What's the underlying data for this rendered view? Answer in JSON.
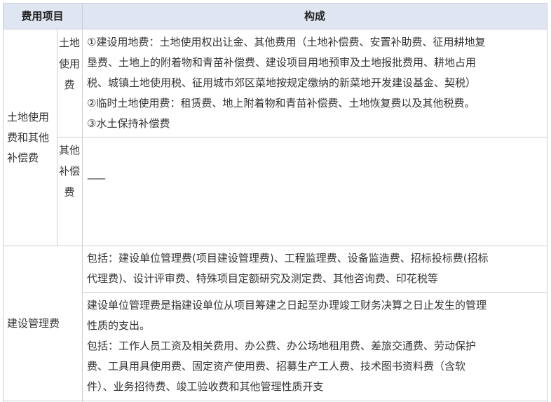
{
  "table": {
    "headers": {
      "item": "费用项目",
      "composition": "构成"
    },
    "rows": [
      {
        "group": "土地使用费和其他补偿费",
        "sub_a": {
          "label": "土地使用费",
          "lines": [
            "①建设用地费：土地使用权出让金、其他费用（土地补偿费、安置补助费、征用耕地复",
            "垦费、土地上的附着物和青苗补偿费、建设项目用地预审及土地报批费用、耕地占用",
            "税、城镇土地使用税、征用城市郊区菜地按规定缴纳的新菜地开发建设基金、契税）",
            "②临时土地使用费：租赁费、地上附着物和青苗补偿费、土地恢复费以及其他税费。",
            "③水土保持补偿费"
          ]
        },
        "sub_b": {
          "label": "其他补偿费",
          "value": "——"
        }
      },
      {
        "group": "建设管理费",
        "part1_lines": [
          "包括：建设单位管理费(项目建设管理费)、工程监理费、设备监造费、招标投标费(招标",
          "代理费)、设计评审费、特殊项目定额研究及测定费、其他咨询费、印花税等"
        ],
        "part2_lines": [
          "建设单位管理费是指建设单位从项目筹建之日起至办理竣工财务决算之日止发生的管理",
          "性质的支出。",
          "包括：工作人员工资及相关费用、办公费、办公场地租用费、差旅交通费、劳动保护",
          "费、工具用具使用费、固定资产使用费、招募生产工人费、技术图书资料费（含软",
          "件）、业务招待费、竣工验收费和其他管理性质开支"
        ]
      }
    ]
  },
  "colors": {
    "header_bg": "#dfe6f2",
    "border": "#c9ced6",
    "text": "#333333"
  }
}
